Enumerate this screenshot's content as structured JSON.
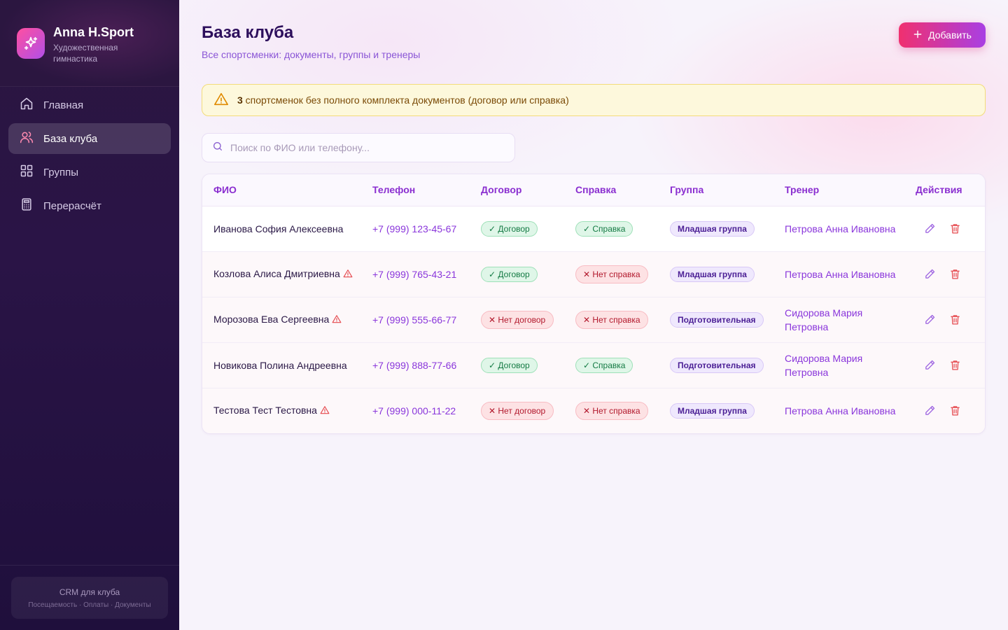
{
  "brand": {
    "name": "Anna H.Sport",
    "subtitle": "Художественная гимнастика"
  },
  "nav": [
    {
      "label": "Главная",
      "icon": "home-icon",
      "active": false
    },
    {
      "label": "База клуба",
      "icon": "users-icon",
      "active": true
    },
    {
      "label": "Группы",
      "icon": "grid-icon",
      "active": false
    },
    {
      "label": "Перерасчёт",
      "icon": "calculator-icon",
      "active": false
    }
  ],
  "footer": {
    "title": "CRM для клуба",
    "subtitle": "Посещаемость · Оплаты · Документы"
  },
  "header": {
    "title": "База клуба",
    "subtitle": "Все спортсменки: документы, группы и тренеры",
    "add_label": "Добавить"
  },
  "alert": {
    "count": "3",
    "text": " спортсменок без полного комплекта документов (договор или справка)"
  },
  "search": {
    "placeholder": "Поиск по ФИО или телефону...",
    "value": ""
  },
  "table": {
    "columns": [
      "ФИО",
      "Телефон",
      "Договор",
      "Справка",
      "Группа",
      "Тренер",
      "Действия"
    ],
    "rows": [
      {
        "name": "Иванова София Алексеевна",
        "warning": false,
        "phone": "+7 (999) 123-45-67",
        "contract": "✓ Договор",
        "contract_ok": true,
        "certificate": "✓ Справка",
        "certificate_ok": true,
        "group": "Младшая группа",
        "coach": "Петрова Анна Ивановна"
      },
      {
        "name": "Козлова Алиса Дмитриевна",
        "warning": true,
        "phone": "+7 (999) 765-43-21",
        "contract": "✓ Договор",
        "contract_ok": true,
        "certificate": "✕ Нет справка",
        "certificate_ok": false,
        "group": "Младшая группа",
        "coach": "Петрова Анна Ивановна"
      },
      {
        "name": "Морозова Ева Сергеевна",
        "warning": true,
        "phone": "+7 (999) 555-66-77",
        "contract": "✕ Нет договор",
        "contract_ok": false,
        "certificate": "✕ Нет справка",
        "certificate_ok": false,
        "group": "Подготовительная",
        "coach": "Сидорова Мария Петровна"
      },
      {
        "name": "Новикова Полина Андреевна",
        "warning": false,
        "phone": "+7 (999) 888-77-66",
        "contract": "✓ Договор",
        "contract_ok": true,
        "certificate": "✓ Справка",
        "certificate_ok": true,
        "group": "Подготовительная",
        "coach": "Сидорова Мария Петровна"
      },
      {
        "name": "Тестова Тест Тестовна",
        "warning": true,
        "phone": "+7 (999) 000-11-22",
        "contract": "✕ Нет договор",
        "contract_ok": false,
        "certificate": "✕ Нет справка",
        "certificate_ok": false,
        "group": "Младшая группа",
        "coach": "Петрова Анна Ивановна"
      }
    ]
  },
  "colors": {
    "accent": "#8a36db",
    "brand_gradient_start": "#f0306f",
    "brand_gradient_end": "#a93fe3",
    "ok": "#137a43",
    "error": "#b2182c",
    "warning": "#e5484d"
  }
}
